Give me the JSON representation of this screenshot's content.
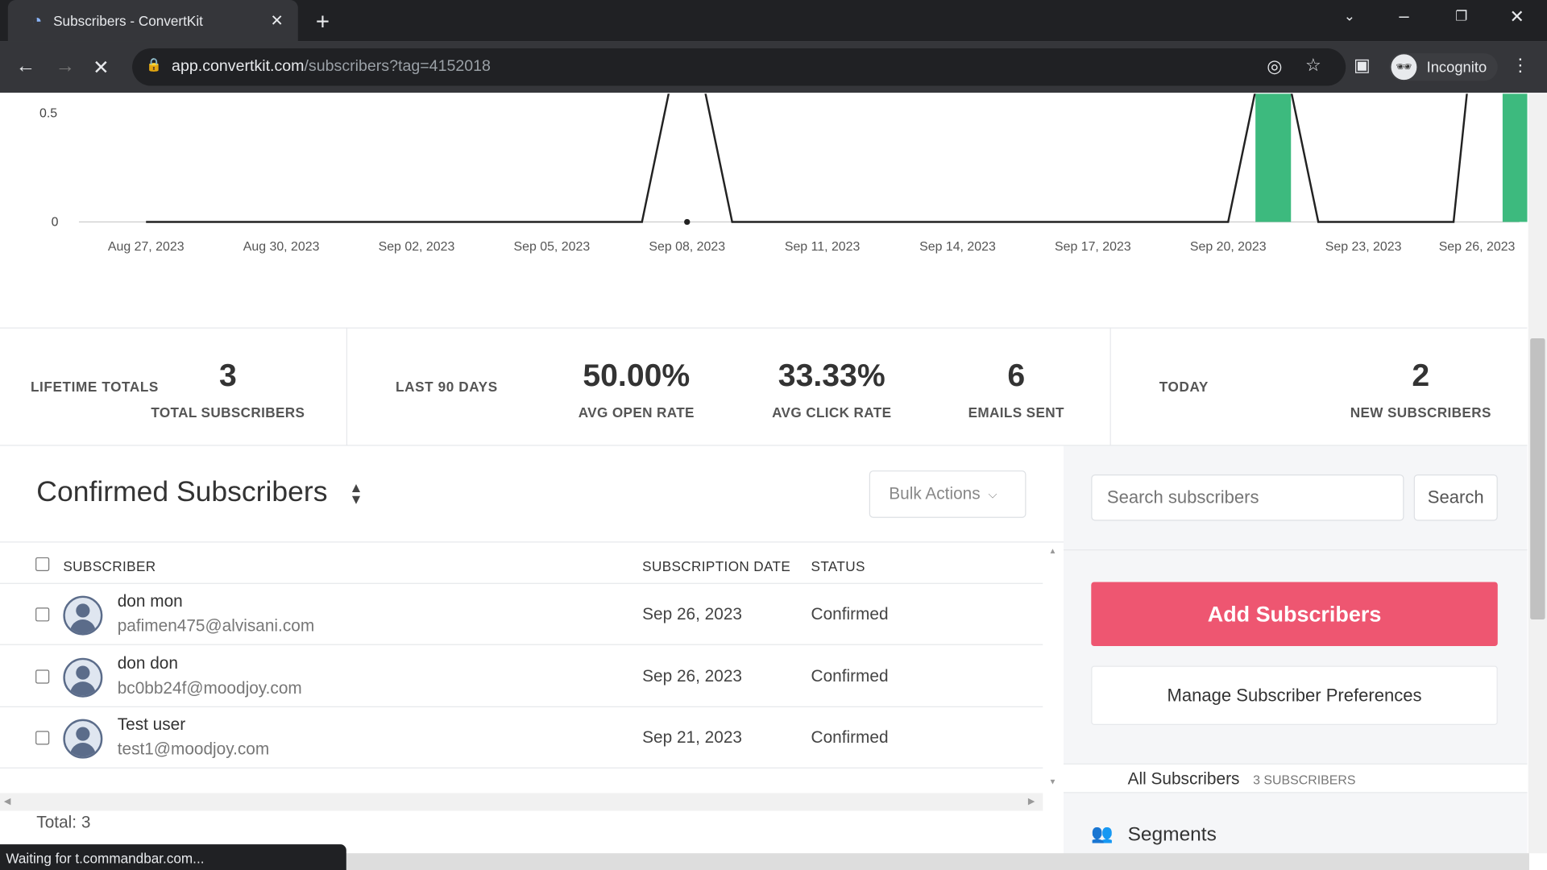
{
  "browser": {
    "tab_title": "Subscribers - ConvertKit",
    "url_host": "app.convertkit.com",
    "url_path": "/subscribers?tag=4152018",
    "profile": "Incognito",
    "status": "Waiting for t.commandbar.com..."
  },
  "chart_data": {
    "type": "bar+line",
    "y_ticks": [
      "0",
      "0.5"
    ],
    "x_ticks": [
      "Aug 27, 2023",
      "Aug 30, 2023",
      "Sep 02, 2023",
      "Sep 05, 2023",
      "Sep 08, 2023",
      "Sep 11, 2023",
      "Sep 14, 2023",
      "Sep 17, 2023",
      "Sep 20, 2023",
      "Sep 23, 2023",
      "Sep 26, 2023"
    ],
    "bars": [
      {
        "x": "Sep 21, 2023",
        "value": 1
      },
      {
        "x": "Sep 26, 2023",
        "value": 2
      }
    ],
    "line": [
      {
        "x": "Aug 27, 2023",
        "value": 0
      },
      {
        "x": "Sep 07, 2023",
        "value": 0
      },
      {
        "x": "Sep 08, 2023",
        "value": 1
      },
      {
        "x": "Sep 09, 2023",
        "value": 0
      },
      {
        "x": "Sep 20, 2023",
        "value": 0
      },
      {
        "x": "Sep 21, 2023",
        "value": 1
      },
      {
        "x": "Sep 22, 2023",
        "value": 0
      },
      {
        "x": "Sep 25, 2023",
        "value": 0
      },
      {
        "x": "Sep 26, 2023",
        "value": 2
      }
    ],
    "bar_color": "#3dba7e",
    "line_color": "#222222"
  },
  "stats": {
    "lifetime_label": "LIFETIME TOTALS",
    "total_subscribers": "3",
    "total_subscribers_label": "TOTAL SUBSCRIBERS",
    "last90_label": "LAST 90 DAYS",
    "open_rate": "50.00%",
    "open_rate_label": "AVG OPEN RATE",
    "click_rate": "33.33%",
    "click_rate_label": "AVG CLICK RATE",
    "emails_sent": "6",
    "emails_sent_label": "EMAILS SENT",
    "today_label": "TODAY",
    "new_subscribers": "2",
    "new_subscribers_label": "NEW SUBSCRIBERS"
  },
  "list": {
    "title": "Confirmed Subscribers",
    "bulk_actions": "Bulk Actions",
    "columns": [
      "SUBSCRIBER",
      "SUBSCRIPTION DATE",
      "STATUS"
    ],
    "rows": [
      {
        "name": "don mon",
        "email": "pafimen475@alvisani.com",
        "date": "Sep 26, 2023",
        "status": "Confirmed"
      },
      {
        "name": "don don",
        "email": "bc0bb24f@moodjoy.com",
        "date": "Sep 26, 2023",
        "status": "Confirmed"
      },
      {
        "name": "Test user",
        "email": "test1@moodjoy.com",
        "date": "Sep 21, 2023",
        "status": "Confirmed"
      }
    ],
    "total": "Total: 3"
  },
  "sidebar": {
    "search_placeholder": "Search subscribers",
    "search_button": "Search",
    "add_button": "Add Subscribers",
    "manage_button": "Manage Subscriber Preferences",
    "all_label": "All Subscribers",
    "all_count": "3 SUBSCRIBERS",
    "segments": "Segments",
    "accent": "#ee5671"
  }
}
